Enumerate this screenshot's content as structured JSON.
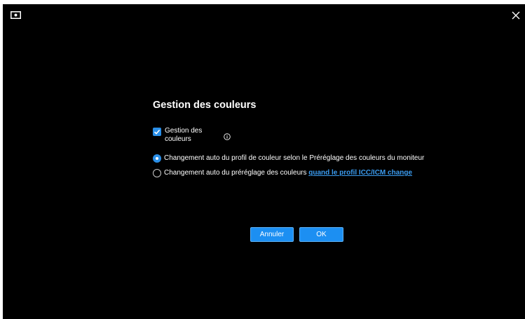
{
  "window": {
    "app_icon": "monitor-settings-icon",
    "close_icon": "close-icon"
  },
  "dialog": {
    "title": "Gestion des couleurs",
    "checkbox": {
      "label": "Gestion des couleurs",
      "checked": true,
      "info_icon": "info-icon"
    },
    "options": [
      {
        "text": "Changement auto du profil de couleur selon le Préréglage des couleurs du moniteur",
        "selected": true
      },
      {
        "text": "Changement auto du préréglage des couleurs ",
        "link_text": "quand le profil ICC/ICM change",
        "selected": false
      }
    ],
    "buttons": {
      "cancel_label": "Annuler",
      "ok_label": "OK"
    }
  },
  "colors": {
    "background": "#000000",
    "accent": "#1c8ff2",
    "link": "#3b9cf0",
    "text": "#ffffff"
  }
}
